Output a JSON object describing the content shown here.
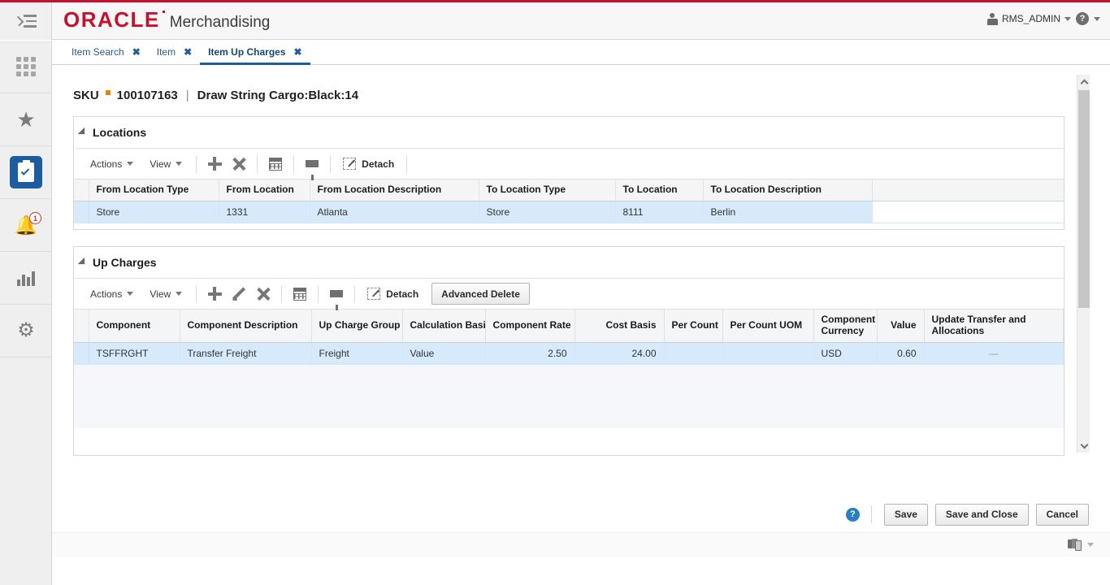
{
  "header": {
    "brand": "ORACLE",
    "app_name": "Merchandising",
    "menu_icon": "hamburger-icon",
    "user": "RMS_ADMIN",
    "help_glyph": "?",
    "accent_red": "#c8102e",
    "accent_blue": "#1d5c9e"
  },
  "rail": {
    "items": [
      {
        "name": "apps-grid",
        "icon": "grid-icon",
        "label": ""
      },
      {
        "name": "favorites",
        "icon": "star-icon",
        "label": ""
      },
      {
        "name": "tasks",
        "icon": "clipboard-check-icon",
        "label": "",
        "active": true
      },
      {
        "name": "notifications",
        "icon": "bell-icon",
        "label": "",
        "badge": "1"
      },
      {
        "name": "reports",
        "icon": "bar-chart-icon",
        "label": ""
      },
      {
        "name": "settings",
        "icon": "gear-icon",
        "label": ""
      }
    ]
  },
  "tabs": [
    {
      "label": "Item Search",
      "active": false,
      "close": "✖"
    },
    {
      "label": "Item",
      "active": false,
      "close": "✖"
    },
    {
      "label": "Item Up Charges",
      "active": true,
      "close": "✖"
    }
  ],
  "page": {
    "title_label": "SKU",
    "sku": "100107163",
    "separator": "|",
    "description": "Draw String Cargo:Black:14"
  },
  "locations": {
    "panel_title": "Locations",
    "toolbar": {
      "actions_label": "Actions",
      "view_label": "View",
      "add_icon": "plus-icon",
      "delete_icon": "close-x-icon",
      "export_icon": "export-spreadsheet-icon",
      "filter_icon": "filter-funnel-icon",
      "detach_label": "Detach",
      "detach_icon": "detach-icon"
    },
    "columns": [
      "From Location Type",
      "From Location",
      "From Location Description",
      "To Location Type",
      "To Location",
      "To Location Description"
    ],
    "rows": [
      {
        "selected": true,
        "cells": [
          "Store",
          "1331",
          "Atlanta",
          "Store",
          "8111",
          "Berlin"
        ]
      }
    ]
  },
  "up_charges": {
    "panel_title": "Up Charges",
    "toolbar": {
      "actions_label": "Actions",
      "view_label": "View",
      "add_icon": "plus-icon",
      "edit_icon": "pencil-icon",
      "delete_icon": "close-x-icon",
      "export_icon": "export-spreadsheet-icon",
      "filter_icon": "filter-funnel-icon",
      "detach_label": "Detach",
      "detach_icon": "detach-icon",
      "advanced_delete_label": "Advanced Delete"
    },
    "columns": [
      {
        "label": "Component",
        "align": "left"
      },
      {
        "label": "Component Description",
        "align": "left"
      },
      {
        "label": "Up Charge Group",
        "align": "left"
      },
      {
        "label": "Calculation Basis",
        "align": "left"
      },
      {
        "label": "Component Rate",
        "align": "right"
      },
      {
        "label": "Cost Basis",
        "align": "right"
      },
      {
        "label": "Per Count",
        "align": "right"
      },
      {
        "label": "Per Count UOM",
        "align": "left"
      },
      {
        "label": "Component Currency",
        "align": "left"
      },
      {
        "label": "Value",
        "align": "right"
      },
      {
        "label": "Update Transfer and Allocations",
        "align": "left"
      }
    ],
    "rows": [
      {
        "selected": true,
        "cells": [
          "TSFFRGHT",
          "Transfer Freight",
          "Freight",
          "Value",
          "2.50",
          "24.00",
          "",
          "",
          "USD",
          "0.60",
          "—"
        ]
      }
    ]
  },
  "action_bar": {
    "help_glyph": "?",
    "buttons": [
      "Save",
      "Save and Close",
      "Cancel"
    ]
  },
  "footer": {
    "process_icon": "processes-icon",
    "caret_icon": "chevron-down-icon"
  },
  "scrollbar": {
    "up_icon": "chevron-up-icon",
    "down_icon": "chevron-down-icon"
  }
}
